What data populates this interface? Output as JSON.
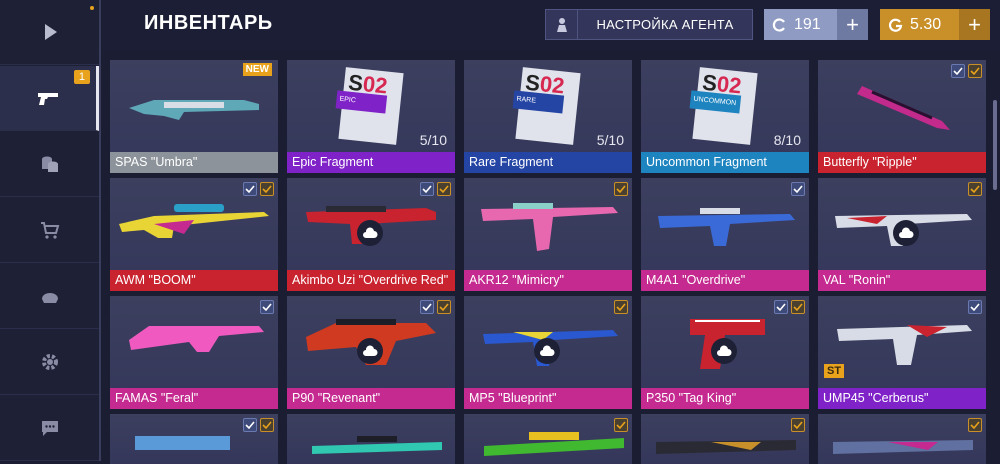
{
  "header": {
    "title": "ИНВЕНТАРЬ",
    "agent_button": "НАСТРОЙКА АГЕНТА",
    "silver": "191",
    "gold": "5.30"
  },
  "sidebar": {
    "badge": "1"
  },
  "cards": [
    {
      "name": "SPAS \"Umbra\"",
      "color": "#8c939a"
    },
    {
      "name": "Epic Fragment",
      "count": "5/10",
      "tag": "EPIC",
      "color": "#7f22c8"
    },
    {
      "name": "Rare Fragment",
      "count": "5/10",
      "tag": "RARE",
      "color": "#2545a5"
    },
    {
      "name": "Uncommon Fragment",
      "count": "8/10",
      "tag": "UNCOMMON",
      "color": "#1d84c0"
    },
    {
      "name": "Butterfly \"Ripple\"",
      "color": "#c8232f"
    },
    {
      "name": "AWM \"BOOM\"",
      "color": "#c8232f"
    },
    {
      "name": "Akimbo Uzi \"Overdrive Red\"",
      "color": "#c8232f"
    },
    {
      "name": "AKR12 \"Mimicry\"",
      "color": "#c42a8f"
    },
    {
      "name": "M4A1 \"Overdrive\"",
      "color": "#c42a8f"
    },
    {
      "name": "VAL \"Ronin\"",
      "color": "#c42a8f"
    },
    {
      "name": "FAMAS \"Feral\"",
      "color": "#c42a8f"
    },
    {
      "name": "P90 \"Revenant\"",
      "color": "#c42a8f"
    },
    {
      "name": "MP5 \"Blueprint\"",
      "color": "#c42a8f"
    },
    {
      "name": "P350 \"Tag King\"",
      "color": "#c42a8f"
    },
    {
      "name": "UMP45 \"Cerberus\"",
      "color": "#7f22c8"
    }
  ],
  "badges": {
    "new": "NEW",
    "st": "ST"
  }
}
